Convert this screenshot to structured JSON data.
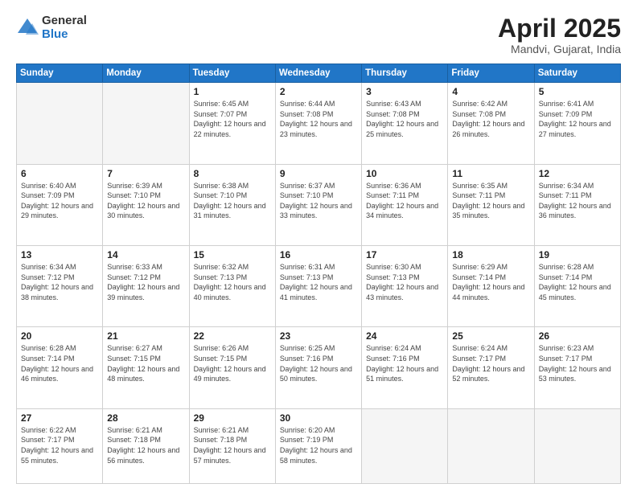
{
  "header": {
    "logo_general": "General",
    "logo_blue": "Blue",
    "month_title": "April 2025",
    "location": "Mandvi, Gujarat, India"
  },
  "days_of_week": [
    "Sunday",
    "Monday",
    "Tuesday",
    "Wednesday",
    "Thursday",
    "Friday",
    "Saturday"
  ],
  "weeks": [
    [
      {
        "day": "",
        "empty": true
      },
      {
        "day": "",
        "empty": true
      },
      {
        "day": "1",
        "sunrise": "Sunrise: 6:45 AM",
        "sunset": "Sunset: 7:07 PM",
        "daylight": "Daylight: 12 hours and 22 minutes."
      },
      {
        "day": "2",
        "sunrise": "Sunrise: 6:44 AM",
        "sunset": "Sunset: 7:08 PM",
        "daylight": "Daylight: 12 hours and 23 minutes."
      },
      {
        "day": "3",
        "sunrise": "Sunrise: 6:43 AM",
        "sunset": "Sunset: 7:08 PM",
        "daylight": "Daylight: 12 hours and 25 minutes."
      },
      {
        "day": "4",
        "sunrise": "Sunrise: 6:42 AM",
        "sunset": "Sunset: 7:08 PM",
        "daylight": "Daylight: 12 hours and 26 minutes."
      },
      {
        "day": "5",
        "sunrise": "Sunrise: 6:41 AM",
        "sunset": "Sunset: 7:09 PM",
        "daylight": "Daylight: 12 hours and 27 minutes."
      }
    ],
    [
      {
        "day": "6",
        "sunrise": "Sunrise: 6:40 AM",
        "sunset": "Sunset: 7:09 PM",
        "daylight": "Daylight: 12 hours and 29 minutes."
      },
      {
        "day": "7",
        "sunrise": "Sunrise: 6:39 AM",
        "sunset": "Sunset: 7:10 PM",
        "daylight": "Daylight: 12 hours and 30 minutes."
      },
      {
        "day": "8",
        "sunrise": "Sunrise: 6:38 AM",
        "sunset": "Sunset: 7:10 PM",
        "daylight": "Daylight: 12 hours and 31 minutes."
      },
      {
        "day": "9",
        "sunrise": "Sunrise: 6:37 AM",
        "sunset": "Sunset: 7:10 PM",
        "daylight": "Daylight: 12 hours and 33 minutes."
      },
      {
        "day": "10",
        "sunrise": "Sunrise: 6:36 AM",
        "sunset": "Sunset: 7:11 PM",
        "daylight": "Daylight: 12 hours and 34 minutes."
      },
      {
        "day": "11",
        "sunrise": "Sunrise: 6:35 AM",
        "sunset": "Sunset: 7:11 PM",
        "daylight": "Daylight: 12 hours and 35 minutes."
      },
      {
        "day": "12",
        "sunrise": "Sunrise: 6:34 AM",
        "sunset": "Sunset: 7:11 PM",
        "daylight": "Daylight: 12 hours and 36 minutes."
      }
    ],
    [
      {
        "day": "13",
        "sunrise": "Sunrise: 6:34 AM",
        "sunset": "Sunset: 7:12 PM",
        "daylight": "Daylight: 12 hours and 38 minutes."
      },
      {
        "day": "14",
        "sunrise": "Sunrise: 6:33 AM",
        "sunset": "Sunset: 7:12 PM",
        "daylight": "Daylight: 12 hours and 39 minutes."
      },
      {
        "day": "15",
        "sunrise": "Sunrise: 6:32 AM",
        "sunset": "Sunset: 7:13 PM",
        "daylight": "Daylight: 12 hours and 40 minutes."
      },
      {
        "day": "16",
        "sunrise": "Sunrise: 6:31 AM",
        "sunset": "Sunset: 7:13 PM",
        "daylight": "Daylight: 12 hours and 41 minutes."
      },
      {
        "day": "17",
        "sunrise": "Sunrise: 6:30 AM",
        "sunset": "Sunset: 7:13 PM",
        "daylight": "Daylight: 12 hours and 43 minutes."
      },
      {
        "day": "18",
        "sunrise": "Sunrise: 6:29 AM",
        "sunset": "Sunset: 7:14 PM",
        "daylight": "Daylight: 12 hours and 44 minutes."
      },
      {
        "day": "19",
        "sunrise": "Sunrise: 6:28 AM",
        "sunset": "Sunset: 7:14 PM",
        "daylight": "Daylight: 12 hours and 45 minutes."
      }
    ],
    [
      {
        "day": "20",
        "sunrise": "Sunrise: 6:28 AM",
        "sunset": "Sunset: 7:14 PM",
        "daylight": "Daylight: 12 hours and 46 minutes."
      },
      {
        "day": "21",
        "sunrise": "Sunrise: 6:27 AM",
        "sunset": "Sunset: 7:15 PM",
        "daylight": "Daylight: 12 hours and 48 minutes."
      },
      {
        "day": "22",
        "sunrise": "Sunrise: 6:26 AM",
        "sunset": "Sunset: 7:15 PM",
        "daylight": "Daylight: 12 hours and 49 minutes."
      },
      {
        "day": "23",
        "sunrise": "Sunrise: 6:25 AM",
        "sunset": "Sunset: 7:16 PM",
        "daylight": "Daylight: 12 hours and 50 minutes."
      },
      {
        "day": "24",
        "sunrise": "Sunrise: 6:24 AM",
        "sunset": "Sunset: 7:16 PM",
        "daylight": "Daylight: 12 hours and 51 minutes."
      },
      {
        "day": "25",
        "sunrise": "Sunrise: 6:24 AM",
        "sunset": "Sunset: 7:17 PM",
        "daylight": "Daylight: 12 hours and 52 minutes."
      },
      {
        "day": "26",
        "sunrise": "Sunrise: 6:23 AM",
        "sunset": "Sunset: 7:17 PM",
        "daylight": "Daylight: 12 hours and 53 minutes."
      }
    ],
    [
      {
        "day": "27",
        "sunrise": "Sunrise: 6:22 AM",
        "sunset": "Sunset: 7:17 PM",
        "daylight": "Daylight: 12 hours and 55 minutes."
      },
      {
        "day": "28",
        "sunrise": "Sunrise: 6:21 AM",
        "sunset": "Sunset: 7:18 PM",
        "daylight": "Daylight: 12 hours and 56 minutes."
      },
      {
        "day": "29",
        "sunrise": "Sunrise: 6:21 AM",
        "sunset": "Sunset: 7:18 PM",
        "daylight": "Daylight: 12 hours and 57 minutes."
      },
      {
        "day": "30",
        "sunrise": "Sunrise: 6:20 AM",
        "sunset": "Sunset: 7:19 PM",
        "daylight": "Daylight: 12 hours and 58 minutes."
      },
      {
        "day": "",
        "empty": true
      },
      {
        "day": "",
        "empty": true
      },
      {
        "day": "",
        "empty": true
      }
    ]
  ]
}
